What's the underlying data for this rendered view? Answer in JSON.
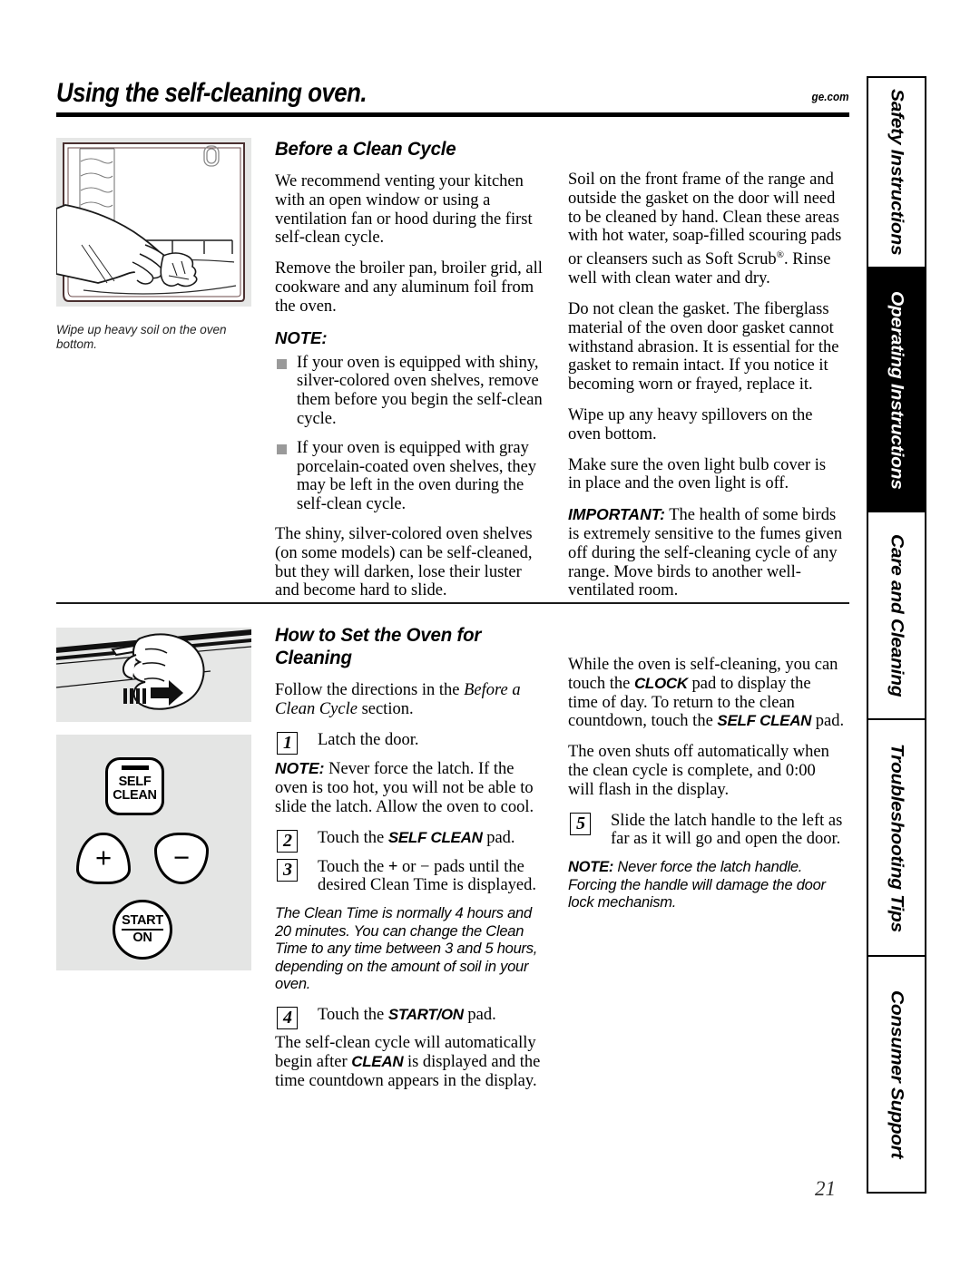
{
  "header": {
    "title": "Using the self-cleaning oven.",
    "url": "ge.com"
  },
  "page_number": "21",
  "side_tabs": [
    {
      "label": "Safety Instructions",
      "active": false
    },
    {
      "label": "Operating Instructions",
      "active": true
    },
    {
      "label": "Care and Cleaning",
      "active": false
    },
    {
      "label": "Troubleshooting Tips",
      "active": false
    },
    {
      "label": "Consumer Support",
      "active": false
    }
  ],
  "figures": {
    "oven_wipe": {
      "caption": "Wipe up heavy soil on the oven bottom.",
      "alt": "Hand wiping the oven bottom with a cloth"
    },
    "latch_slide": {
      "alt": "Hand sliding the oven door latch handle, with a motion arrow"
    },
    "control_panel": {
      "self_clean_line1": "SELF",
      "self_clean_line2": "CLEAN",
      "plus_symbol": "+",
      "minus_symbol": "−",
      "start_line1": "START",
      "start_line2": "ON"
    }
  },
  "section_before": {
    "heading": "Before a Clean Cycle",
    "left": {
      "p1": "We recommend venting your kitchen with an open window or using a ventilation fan or hood during the first self-clean cycle.",
      "p2": "Remove the broiler pan, broiler grid, all cookware and any aluminum foil from the oven.",
      "note_head": "NOTE:",
      "bullets": [
        "If your oven is equipped with shiny, silver-colored oven shelves, remove them before you begin the self-clean cycle.",
        "If your oven is equipped with gray porcelain-coated oven shelves, they may be left in the oven during the self-clean cycle."
      ],
      "p3": "The shiny, silver-colored oven shelves (on some models) can be self-cleaned, but they will darken, lose their luster and become hard to slide."
    },
    "right": {
      "p1_a": "Soil on the front frame of the range and outside the gasket on the door will need to be cleaned by hand. Clean these areas with hot water, soap-filled scouring pads or cleansers such as Soft Scrub",
      "p1_reg": "®",
      "p1_b": ". Rinse well with clean water and dry.",
      "p2": "Do not clean the gasket. The fiberglass material of the oven door gasket cannot withstand abrasion. It is essential for the gasket to remain intact. If you notice it becoming worn or frayed, replace it.",
      "p3": "Wipe up any heavy spillovers on the oven bottom.",
      "p4": "Make sure the oven light bulb cover is in place and the oven light is off.",
      "important_label": "IMPORTANT:",
      "p5": " The health of some birds is extremely sensitive to the fumes given off during the self-cleaning cycle of any range. Move birds to another well-ventilated room."
    }
  },
  "section_howto": {
    "heading": "How to Set the Oven for Cleaning",
    "left": {
      "intro_a": "Follow the directions in the ",
      "intro_ital": "Before a Clean Cycle",
      "intro_b": " section.",
      "step1_num": "1",
      "step1_text": "Latch the door.",
      "note1_label": "NOTE:",
      "note1_text": " Never force the latch. If the oven is too hot, you will not be able to slide the latch. Allow the oven to cool.",
      "step2_num": "2",
      "step2_pre": "Touch the ",
      "step2_pad": "SELF CLEAN",
      "step2_post": " pad.",
      "step3_num": "3",
      "step3_pre": "Touch the ",
      "step3_plus": "+",
      "step3_mid": " or ",
      "step3_minus": "−",
      "step3_post": " pads until the desired Clean Time is displayed.",
      "clean_time_note": "The Clean Time is normally 4 hours and 20 minutes. You can change the Clean Time to any time between 3 and 5 hours, depending on the amount of soil in your oven.",
      "step4_num": "4",
      "step4_pre": "Touch the ",
      "step4_pad": "START/ON",
      "step4_post": " pad.",
      "p_after_a": "The self-clean cycle will automatically begin after ",
      "p_after_pad": "CLEAN",
      "p_after_b": " is displayed and the time countdown appears in the display."
    },
    "right": {
      "p1_a": "While the oven is self-cleaning, you can touch the ",
      "p1_pad1": "CLOCK",
      "p1_b": " pad to display the time of day. To return to the clean countdown, touch the ",
      "p1_pad2": "SELF CLEAN",
      "p1_c": " pad.",
      "p2": "The oven shuts off automatically when the clean cycle is complete, and 0:00 will flash in the display.",
      "step5_num": "5",
      "step5_text": "Slide the latch handle to the left as far as it will go and open the door.",
      "note_label": "NOTE:",
      "note_text": " Never force the latch handle. Forcing the handle will damage the door lock mechanism."
    }
  },
  "colors": {
    "figure_bg": "#e6e7e6",
    "bullet_gray": "#9a9a9a",
    "ink": "#000000"
  }
}
